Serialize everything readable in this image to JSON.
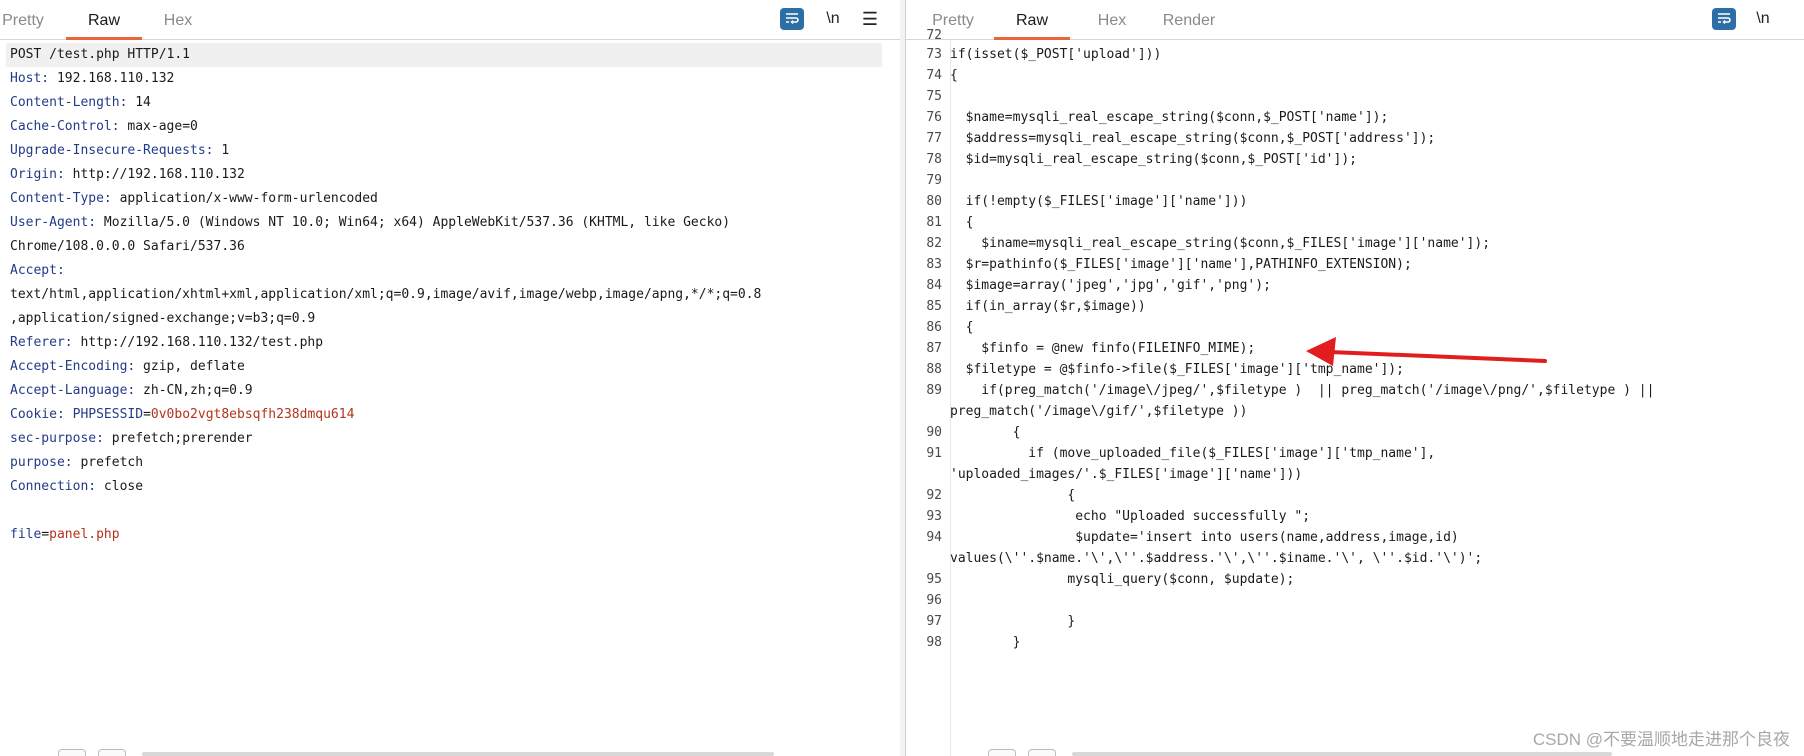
{
  "left": {
    "tabs": [
      "Pretty",
      "Raw",
      "Hex"
    ],
    "active_tab": "Raw",
    "newline_label": "\\n",
    "request": {
      "request_line": "POST /test.php HTTP/1.1",
      "headers": [
        {
          "key": "Host:",
          "value": " 192.168.110.132"
        },
        {
          "key": "Content-Length:",
          "value": " 14"
        },
        {
          "key": "Cache-Control:",
          "value": " max-age=0"
        },
        {
          "key": "Upgrade-Insecure-Requests:",
          "value": " 1"
        },
        {
          "key": "Origin:",
          "value": " http://192.168.110.132"
        },
        {
          "key": "Content-Type:",
          "value": " application/x-www-form-urlencoded"
        },
        {
          "key": "User-Agent:",
          "value": " Mozilla/5.0 (Windows NT 10.0; Win64; x64) AppleWebKit/537.36 (KHTML, like Gecko)"
        },
        {
          "key": "",
          "value": "Chrome/108.0.0.0 Safari/537.36"
        },
        {
          "key": "Accept:",
          "value": ""
        },
        {
          "key": "",
          "value": "text/html,application/xhtml+xml,application/xml;q=0.9,image/avif,image/webp,image/apng,*/*;q=0.8"
        },
        {
          "key": "",
          "value": ",application/signed-exchange;v=b3;q=0.9"
        },
        {
          "key": "Referer:",
          "value": " http://192.168.110.132/test.php"
        },
        {
          "key": "Accept-Encoding:",
          "value": " gzip, deflate"
        },
        {
          "key": "Accept-Language:",
          "value": " zh-CN,zh;q=0.9"
        },
        {
          "key": "Cookie:",
          "cookie_name": " PHPSESSID",
          "cookie_eq": "=",
          "cookie_val": "0v0bo2vgt8ebsqfh238dmqu614"
        },
        {
          "key": "sec-purpose:",
          "value": " prefetch;prerender"
        },
        {
          "key": "purpose:",
          "value": " prefetch"
        },
        {
          "key": "Connection:",
          "value": " close"
        }
      ],
      "body": {
        "param": "file",
        "eq": "=",
        "value": "panel.php"
      }
    }
  },
  "right": {
    "tabs": [
      "Pretty",
      "Raw",
      "Hex",
      "Render"
    ],
    "active_tab": "Raw",
    "newline_label": "\\n",
    "partial_top_line": "72",
    "lines": [
      {
        "n": "73",
        "t": "if(isset($_POST['upload']))"
      },
      {
        "n": "74",
        "t": "{"
      },
      {
        "n": "75",
        "t": ""
      },
      {
        "n": "76",
        "t": "  $name=mysqli_real_escape_string($conn,$_POST['name']);"
      },
      {
        "n": "77",
        "t": "  $address=mysqli_real_escape_string($conn,$_POST['address']);"
      },
      {
        "n": "78",
        "t": "  $id=mysqli_real_escape_string($conn,$_POST['id']);"
      },
      {
        "n": "79",
        "t": ""
      },
      {
        "n": "80",
        "t": "  if(!empty($_FILES['image']['name']))"
      },
      {
        "n": "81",
        "t": "  {"
      },
      {
        "n": "82",
        "t": "    $iname=mysqli_real_escape_string($conn,$_FILES['image']['name']);"
      },
      {
        "n": "83",
        "t": "  $r=pathinfo($_FILES['image']['name'],PATHINFO_EXTENSION);"
      },
      {
        "n": "84",
        "t": "  $image=array('jpeg','jpg','gif','png');"
      },
      {
        "n": "85",
        "t": "  if(in_array($r,$image))"
      },
      {
        "n": "86",
        "t": "  {"
      },
      {
        "n": "87",
        "t": "    $finfo = @new finfo(FILEINFO_MIME);"
      },
      {
        "n": "88",
        "t": "  $filetype = @$finfo->file($_FILES['image']['tmp_name']);"
      },
      {
        "n": "89",
        "t": "    if(preg_match('/image\\/jpeg/',$filetype )  || preg_match('/image\\/png/',$filetype ) ||"
      },
      {
        "n": "",
        "t": "preg_match('/image\\/gif/',$filetype ))"
      },
      {
        "n": "90",
        "t": "        {"
      },
      {
        "n": "91",
        "t": "          if (move_uploaded_file($_FILES['image']['tmp_name'],"
      },
      {
        "n": "",
        "t": "'uploaded_images/'.$_FILES['image']['name']))"
      },
      {
        "n": "92",
        "t": "               {"
      },
      {
        "n": "93",
        "t": "                echo \"Uploaded successfully \";"
      },
      {
        "n": "94",
        "t": "                $update='insert into users(name,address,image,id)"
      },
      {
        "n": "",
        "t": "values(\\''.$name.'\\',\\''.$address.'\\',\\''.$iname.'\\', \\''.$id.'\\')';"
      },
      {
        "n": "95",
        "t": "               mysqli_query($conn, $update);"
      },
      {
        "n": "96",
        "t": ""
      },
      {
        "n": "97",
        "t": "               }"
      },
      {
        "n": "98",
        "t": "        }"
      }
    ]
  },
  "annotation": {
    "type": "arrow",
    "color": "#e11d1d",
    "points_to_line": "85"
  },
  "watermark": "CSDN @不要温顺地走进那个良夜"
}
